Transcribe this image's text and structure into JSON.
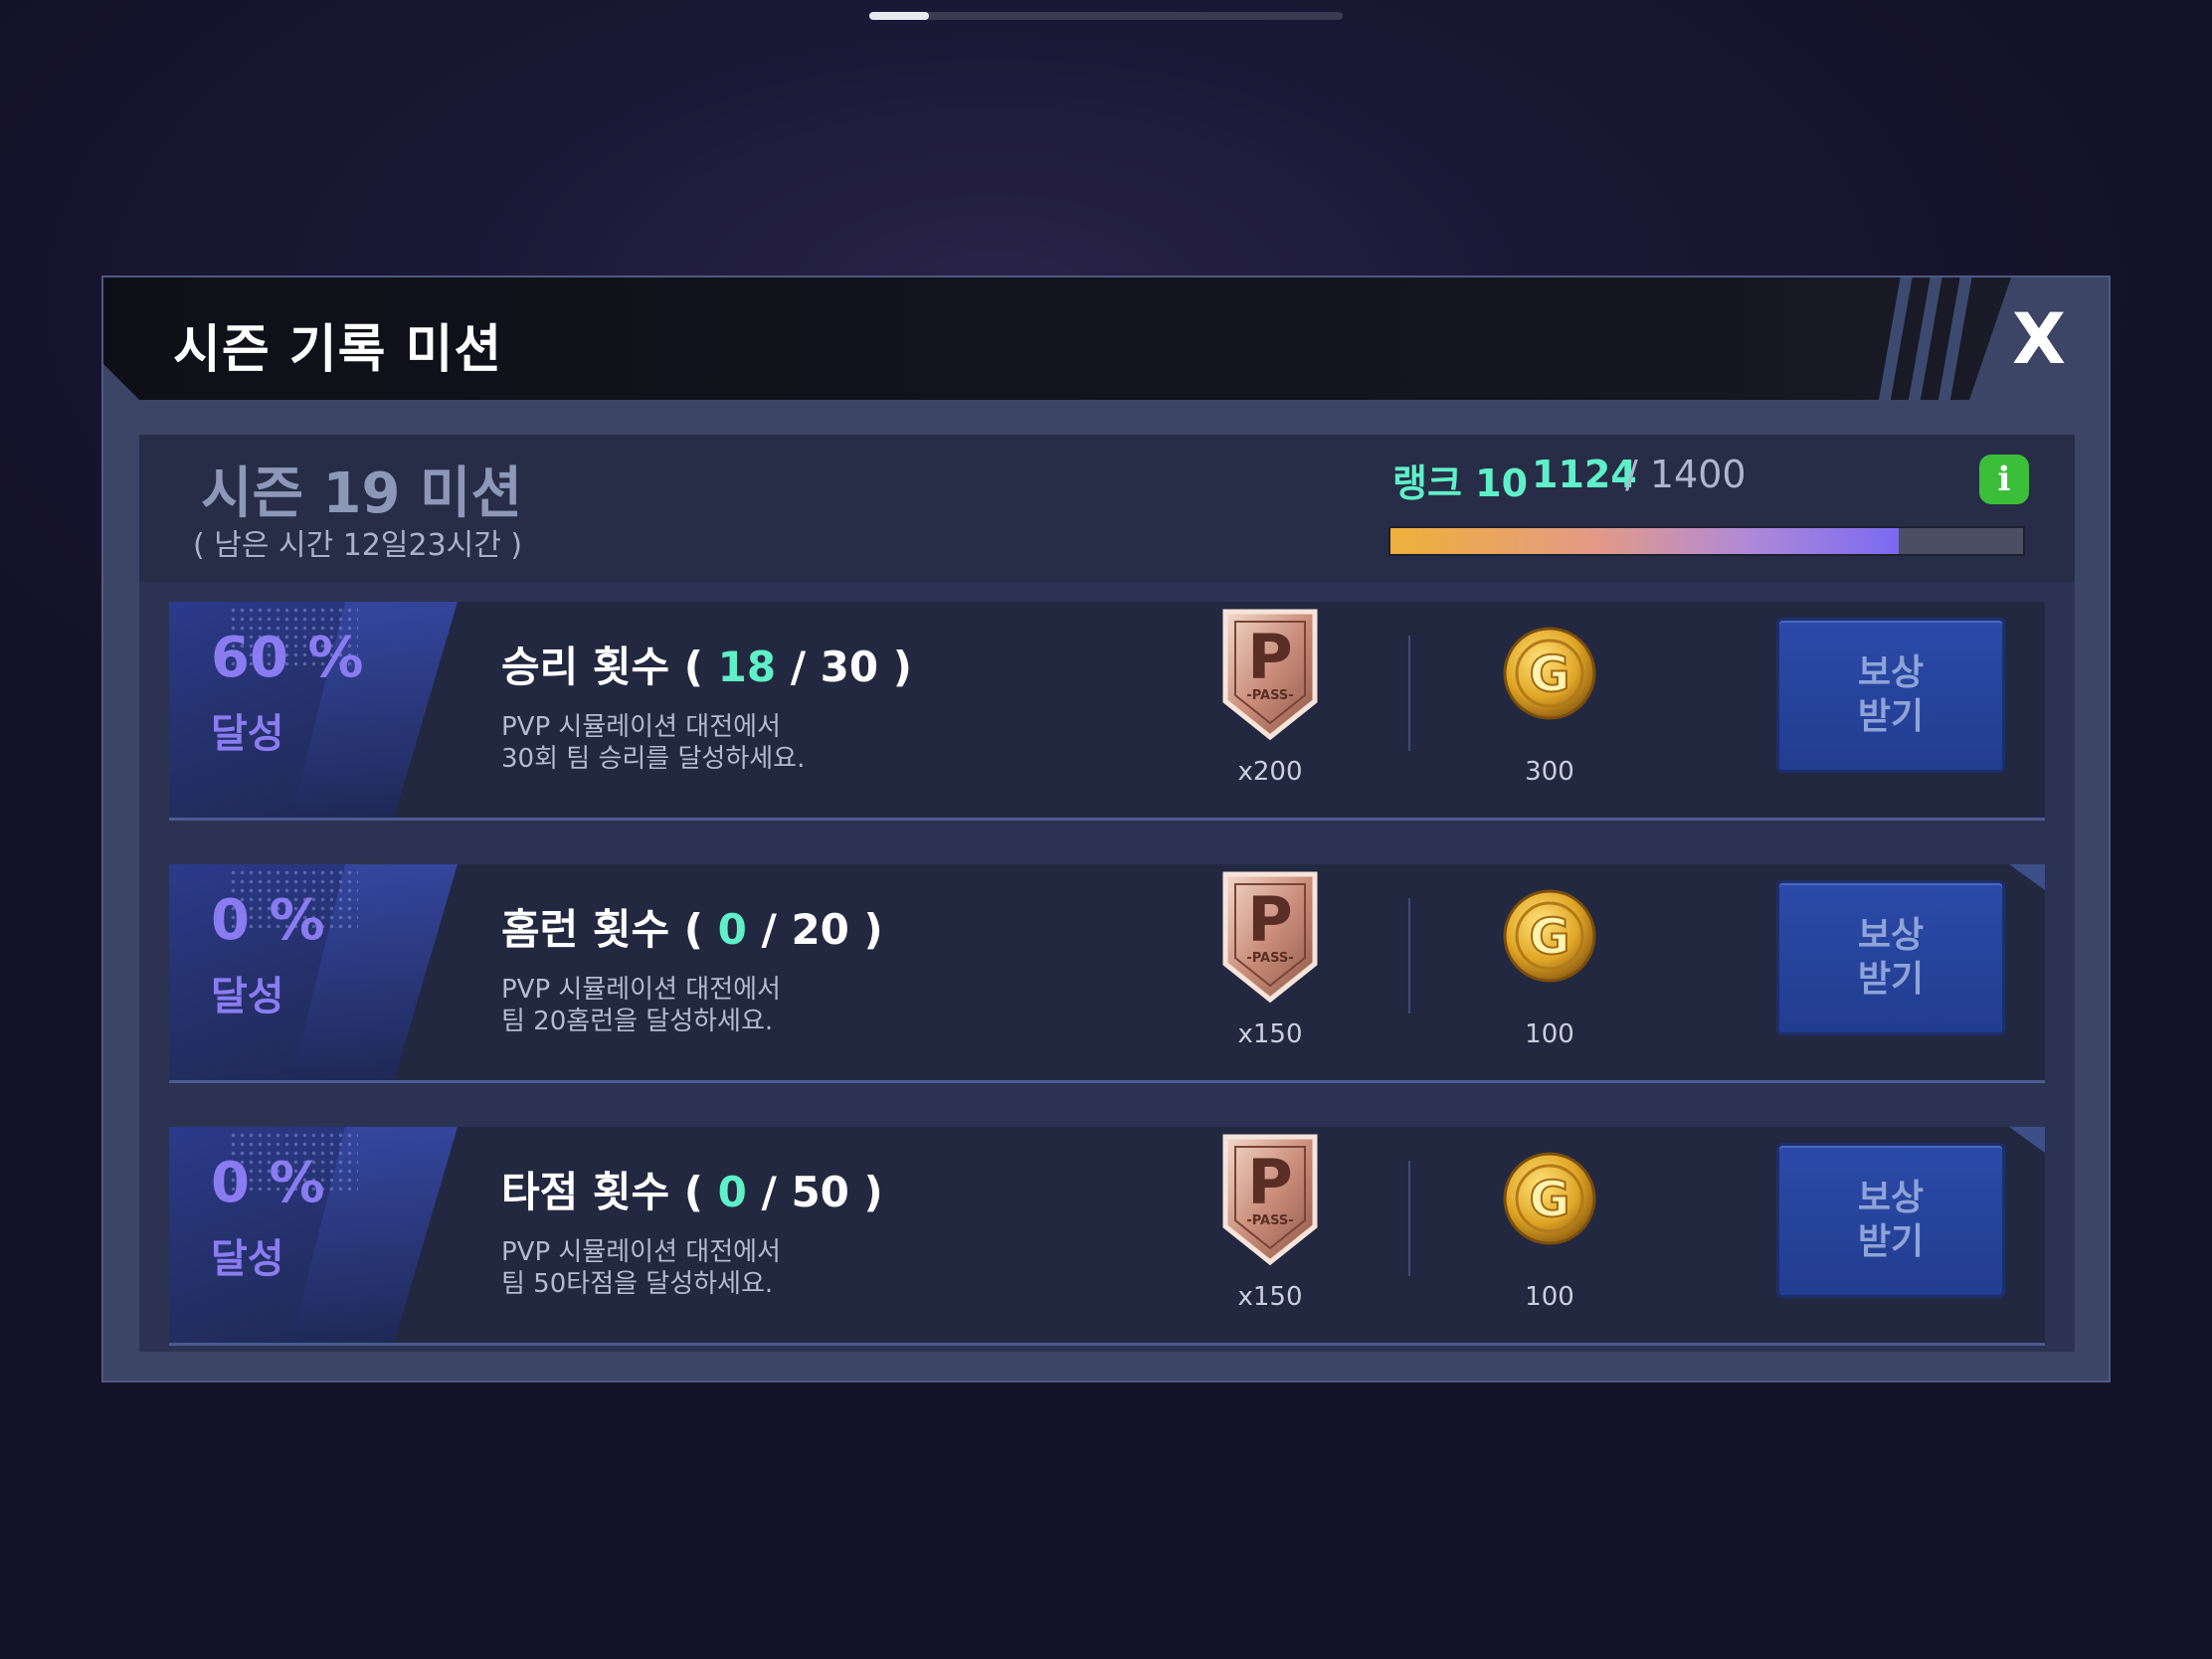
{
  "header": {
    "title": "시즌 기록 미션",
    "close_label": "X"
  },
  "season": {
    "title": "시즌 19 미션",
    "time_left": "( 남은 시간 12일23시간 )",
    "rank": "랭크 10",
    "points_current": "1124",
    "points_max": "/ 1400",
    "progress": 0.803,
    "info_label": "i"
  },
  "missions": [
    {
      "percent": "60 %",
      "achieved": "달성",
      "title": "승리 횟수 (",
      "current": "18",
      "goal": "/ 30 )",
      "desc_line1": "PVP 시뮬레이션 대전에서",
      "desc_line2": "30회 팀 승리를 달성하세요.",
      "pass_reward": "x200",
      "gold_reward": "300",
      "claim_label": "보상\n받기"
    },
    {
      "percent": "0 %",
      "achieved": "달성",
      "title": "홈런 횟수 (",
      "current": "0",
      "goal": "/ 20 )",
      "desc_line1": "PVP 시뮬레이션 대전에서",
      "desc_line2": "팀 20홈런을 달성하세요.",
      "pass_reward": "x150",
      "gold_reward": "100",
      "claim_label": "보상\n받기"
    },
    {
      "percent": "0 %",
      "achieved": "달성",
      "title": "타점 횟수 (",
      "current": "0",
      "goal": "/ 50 )",
      "desc_line1": "PVP 시뮬레이션 대전에서",
      "desc_line2": "팀 50타점을 달성하세요.",
      "pass_reward": "x150",
      "gold_reward": "100",
      "claim_label": "보상\n받기"
    }
  ],
  "badge_text": {
    "pass_letter": "P",
    "pass_sub": "-PASS-",
    "gold_letter": "G"
  },
  "colors": {
    "accent_green": "#5ff0c8",
    "accent_purple": "#8a7cf0",
    "button_blue": "#2b4aa8"
  }
}
